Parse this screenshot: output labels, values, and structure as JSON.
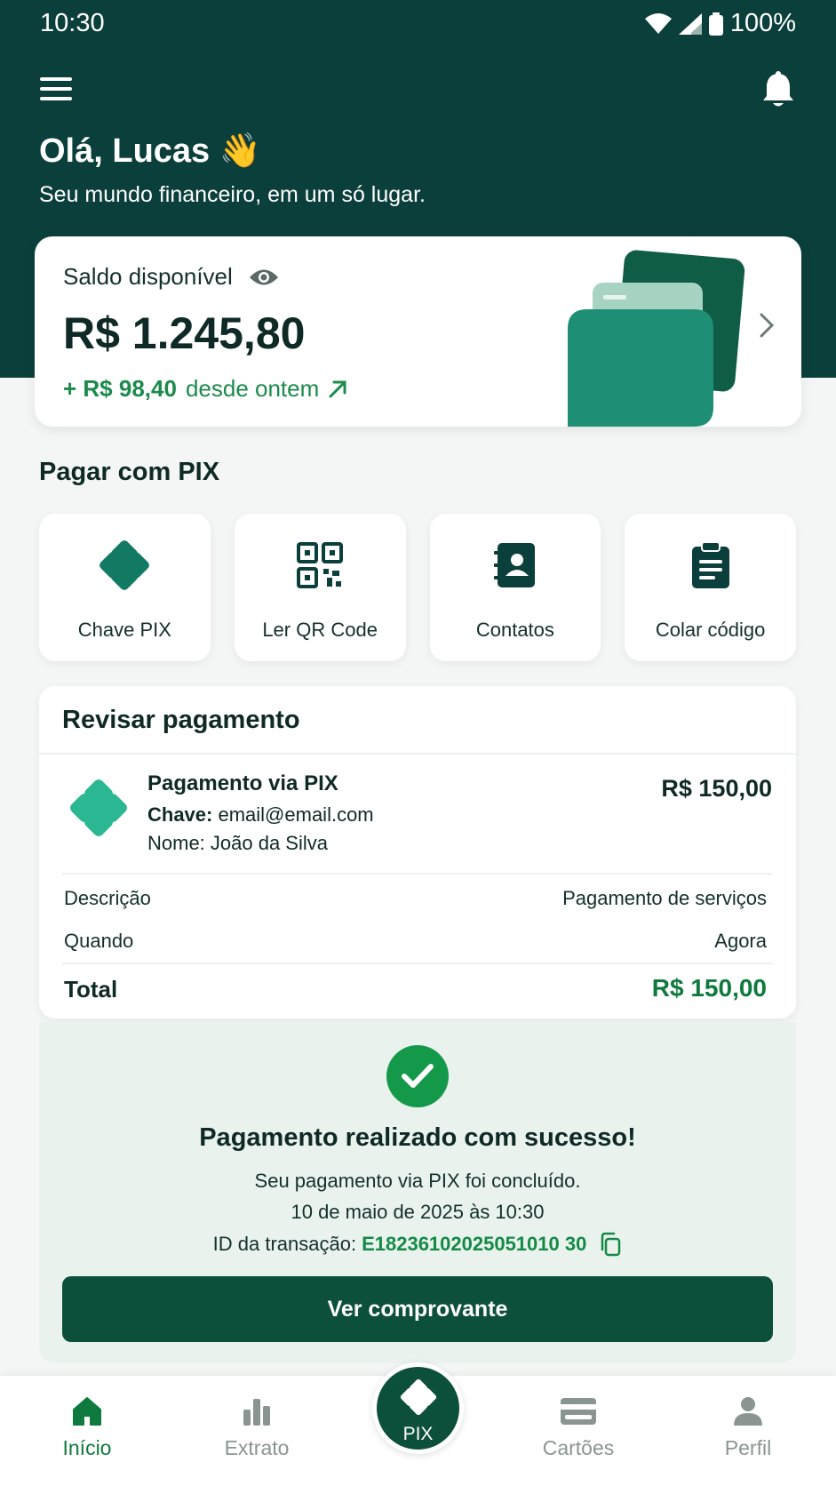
{
  "status_bar": {
    "time": "10:30",
    "battery": "100%"
  },
  "header": {
    "greeting": "Olá, Lucas 👋",
    "subtitle": "Seu mundo financeiro, em um só lugar."
  },
  "balance": {
    "label": "Saldo disponível",
    "value": "R$ 1.245,80",
    "delta_amount": "+ R$ 98,40",
    "delta_text": "desde ontem"
  },
  "pix_section": {
    "title": "Pagar com PIX",
    "actions": [
      {
        "label": "Chave PIX",
        "icon": "pix-key-icon"
      },
      {
        "label": "Ler QR Code",
        "icon": "qr-code-icon"
      },
      {
        "label": "Contatos",
        "icon": "contacts-icon"
      },
      {
        "label": "Colar código",
        "icon": "clipboard-icon"
      }
    ]
  },
  "review": {
    "title": "Revisar pagamento",
    "payment_title": "Pagamento via PIX",
    "key_label": "Chave:",
    "key_value": "email@email.com",
    "name": "Nome: João da Silva",
    "amount": "R$ 150,00",
    "details": [
      {
        "label": "Descrição",
        "value": "Pagamento de serviços"
      },
      {
        "label": "Quando",
        "value": "Agora"
      }
    ],
    "total_label": "Total",
    "total_value": "R$ 150,00"
  },
  "success": {
    "title": "Pagamento realizado com sucesso!",
    "line1": "Seu pagamento via PIX foi concluído.",
    "line2": "10 de maio de 2025 às 10:30",
    "tx_label": "ID da transação:",
    "tx_id": "E18236102025051010 30",
    "button": "Ver comprovante"
  },
  "bottom_nav": {
    "items": [
      {
        "label": "Início",
        "icon": "home-icon",
        "active": true
      },
      {
        "label": "Extrato",
        "icon": "bar-chart-icon",
        "active": false
      },
      {
        "label": "PIX",
        "icon": "pix-icon",
        "active": false
      },
      {
        "label": "Cartões",
        "icon": "card-icon",
        "active": false
      },
      {
        "label": "Perfil",
        "icon": "user-icon",
        "active": false
      }
    ]
  },
  "colors": {
    "header_bg": "#0b3f3b",
    "accent_green": "#0f7a3e",
    "button_bg": "#0c4f3b",
    "success_bg": "#eaf2ee"
  }
}
